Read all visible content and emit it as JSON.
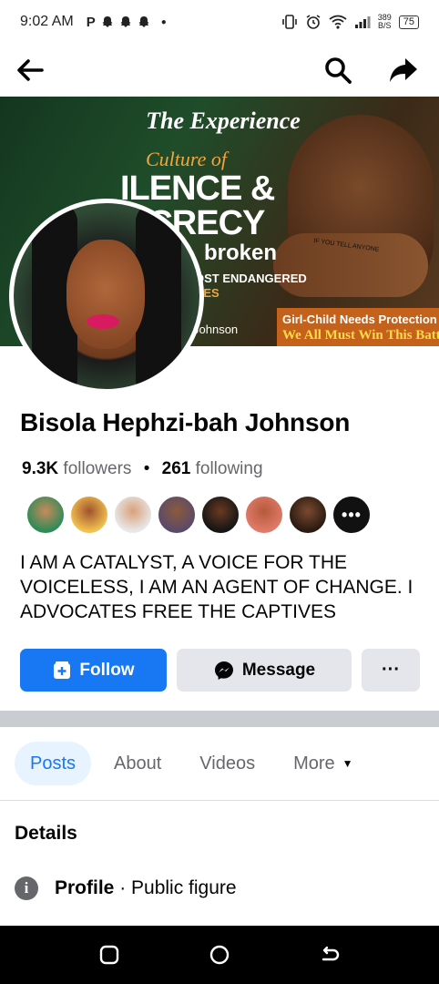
{
  "status_bar": {
    "time": "9:02 AM",
    "left_icons": [
      "parking-icon",
      "snapchat-icon",
      "snapchat-icon",
      "snapchat-icon",
      "dot-icon"
    ],
    "net_speed_value": "389",
    "net_speed_unit": "B/S",
    "battery": "75"
  },
  "cover": {
    "title": "The Experience",
    "line_culture": "Culture of",
    "line_silence": "ILENCE &",
    "line_secrecy": "ECRECY",
    "line_broken": "broken",
    "line_endangered": "OST ENDANGERED",
    "line_ches": "HES",
    "line_name": "Johnson",
    "banner_line1": "Girl-Child Needs Protection",
    "banner_line2": "We All Must Win This Battle",
    "hand_text": "IF YOU TELL ANYONE"
  },
  "profile": {
    "name": "Bisola Hephzi-bah Johnson",
    "followers_count": "9.3K",
    "followers_label": "followers",
    "following_count": "261",
    "following_label": "following",
    "bio": "I AM A CATALYST, A VOICE FOR THE VOICELESS,  I AM AN AGENT OF CHANGE. I ADVOCATES FREE THE CAPTIVES"
  },
  "actions": {
    "follow_label": "Follow",
    "message_label": "Message",
    "more_label": "···"
  },
  "tabs": [
    {
      "label": "Posts"
    },
    {
      "label": "About"
    },
    {
      "label": "Videos"
    },
    {
      "label": "More"
    }
  ],
  "details": {
    "title": "Details",
    "profile_label": "Profile",
    "profile_sep": " · ",
    "profile_value": "Public figure"
  },
  "friends_more": "•••",
  "colors": {
    "accent": "#1877f2",
    "secondary_button": "#e4e6eb",
    "active_tab_bg": "#e7f3ff"
  }
}
